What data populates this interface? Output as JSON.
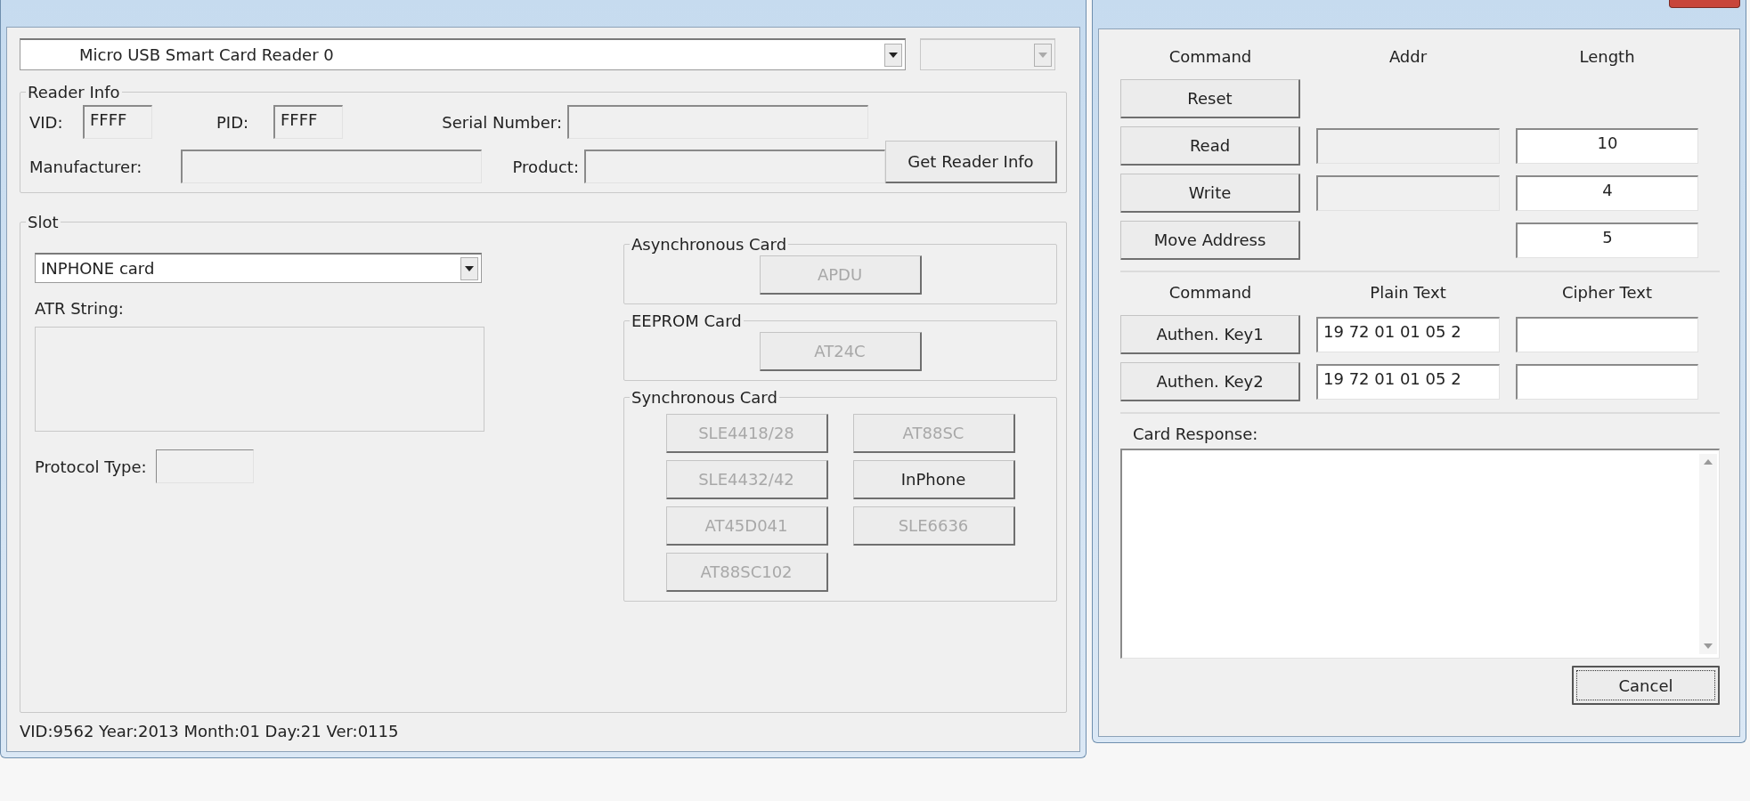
{
  "reader_select": {
    "value": "Micro USB Smart Card Reader 0"
  },
  "secondary_select": {
    "disabled": true
  },
  "reader_info": {
    "title": "Reader Info",
    "fields": [
      {
        "label": "VID:",
        "value": "FFFF",
        "disabled": true
      },
      {
        "label": "PID:",
        "value": "FFFF",
        "disabled": true
      },
      {
        "label": "Serial Number:",
        "disabled": true
      },
      {
        "label": "Manufacturer:",
        "disabled": true
      },
      {
        "label": "Product:",
        "disabled": true
      }
    ],
    "button": {
      "label": "Get Reader Info",
      "disabled": false
    }
  },
  "slot": {
    "title": "Slot",
    "card_type": "INPHONE card",
    "atr_label": "ATR String:",
    "protocol_label": "Protocol Type:",
    "groups": [
      {
        "title": "Asynchronous Card",
        "buttons": [
          {
            "label": "APDU",
            "disabled": true
          }
        ]
      },
      {
        "title": "EEPROM Card",
        "buttons": [
          {
            "label": "AT24C",
            "disabled": true
          }
        ]
      },
      {
        "title": "Synchronous Card",
        "buttons": [
          {
            "label": "SLE4418/28",
            "disabled": true
          },
          {
            "label": "AT88SC",
            "disabled": true
          },
          {
            "label": "SLE4432/42",
            "disabled": true
          },
          {
            "label": "InPhone",
            "disabled": false
          },
          {
            "label": "AT45D041",
            "disabled": true
          },
          {
            "label": "SLE6636",
            "disabled": true
          },
          {
            "label": "AT88SC102",
            "disabled": true
          }
        ]
      }
    ]
  },
  "status_bar": "VID:9562 Year:2013 Month:01 Day:21 Ver:0115",
  "card_control": {
    "headers": [
      "Command",
      "Addr",
      "Length"
    ],
    "rows": [
      {
        "command": "Reset"
      },
      {
        "command": "Read",
        "addr": {
          "disabled": true
        },
        "length": {
          "value": "10",
          "disabled": false
        }
      },
      {
        "command": "Write",
        "addr": {
          "disabled": true
        },
        "length": {
          "value": "4",
          "disabled": false
        }
      },
      {
        "command": "Move Address",
        "length": {
          "value": "5",
          "disabled": false
        }
      }
    ],
    "auth_headers": [
      "Command",
      "Plain Text",
      "Cipher Text"
    ],
    "auth_rows": [
      {
        "command": "Authen. Key1",
        "plain": {
          "value": "19 72 01 01 05 2",
          "disabled": false
        },
        "cipher": {
          "disabled": false
        }
      },
      {
        "command": "Authen. Key2",
        "plain": {
          "value": "19 72 01 01 05 2",
          "disabled": false
        },
        "cipher": {
          "disabled": false
        }
      }
    ],
    "response_label": "Card Response:",
    "cancel": {
      "label": "Cancel",
      "focused": true
    }
  }
}
